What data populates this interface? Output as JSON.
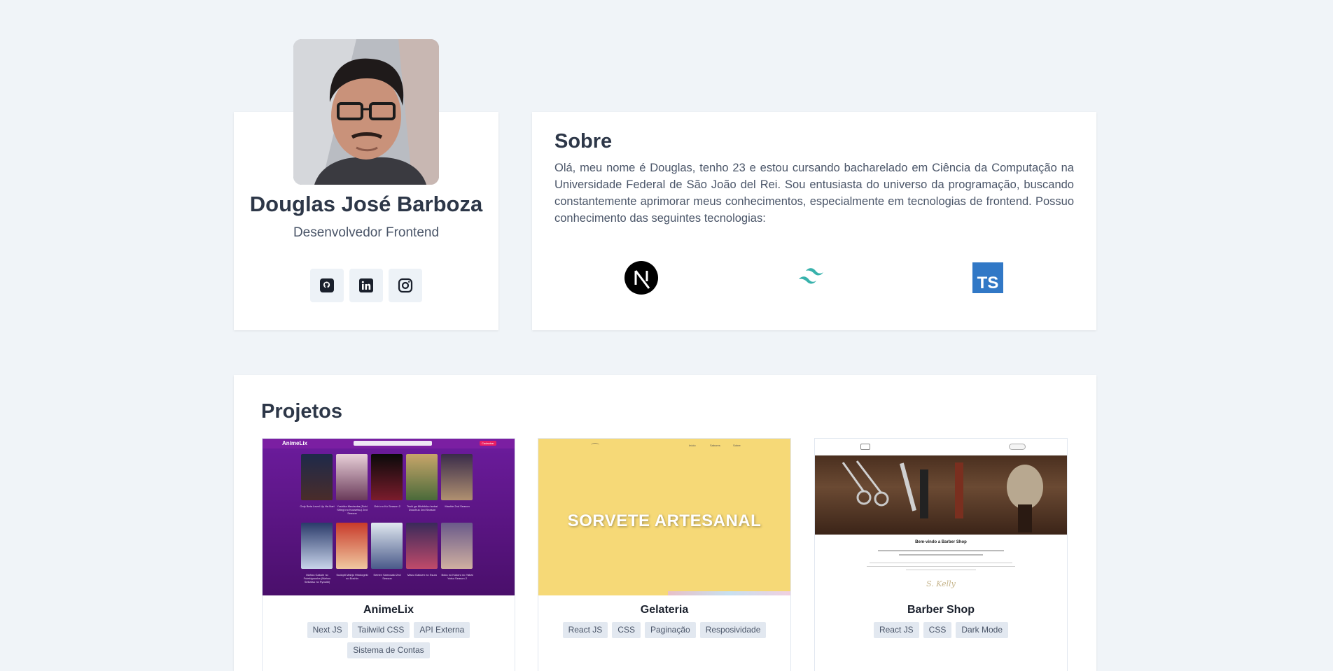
{
  "profile": {
    "name": "Douglas José Barboza",
    "role": "Desenvolvedor Frontend",
    "social": [
      {
        "icon": "github-icon"
      },
      {
        "icon": "linkedin-icon"
      },
      {
        "icon": "instagram-icon"
      }
    ]
  },
  "about": {
    "title": "Sobre",
    "text": "Olá, meu nome é Douglas, tenho 23 e estou cursando bacharelado em Ciência da Computação na Universidade Federal de São João del Rei. Sou entusiasta do universo da programação, buscando constantemente aprimorar meus conhecimentos, especialmente em tecnologias de frontend. Possuo conhecimento das seguintes tecnologias:",
    "technologies": [
      {
        "icon": "nextjs-icon",
        "color": "#000000"
      },
      {
        "icon": "tailwindcss-icon",
        "color": "#38b2ac"
      },
      {
        "icon": "typescript-icon",
        "color": "#3178c6",
        "label": "TS"
      }
    ]
  },
  "projects": {
    "title": "Projetos",
    "items": [
      {
        "name": "AnimeLix",
        "tags": [
          "Next JS",
          "Tailwild CSS",
          "API Externa",
          "Sistema de Contas"
        ],
        "thumb": {
          "logo": "AnimeLix",
          "captions": [
            "Only Beta Level Up Ha Nari",
            "Yoshida Meutsuba (Sobi Shingi no Kousetsu) 2nd Season",
            "Oshi no Ko Season 2",
            "Tsuki ga Michibiku Isekai Douchuu 2nd Season",
            "Mashle 2nd Season",
            "Mahou Gakuin no Futekigousha (Mahou Seikatsu no Ryouiki)",
            "Sudopti Mahjo Hitokogeki no Boshin",
            "Seinen Samouaki 2nd Season",
            "Maou Gakuen no Ssuru",
            "Boku no Kokoro no Yabai Yatsu Season 2"
          ],
          "header_button": "Cadastrar"
        }
      },
      {
        "name": "Gelateria",
        "tags": [
          "React JS",
          "CSS",
          "Paginação",
          "Resposividade"
        ],
        "thumb": {
          "headline": "SORVETE ARTESANAL",
          "nav": [
            "Início",
            "Sabores",
            "Sobre"
          ]
        }
      },
      {
        "name": "Barber Shop",
        "tags": [
          "React JS",
          "CSS",
          "Dark Mode"
        ],
        "thumb": {
          "welcome": "Bem-vindo a Barber Shop",
          "signature": "S. Kelly"
        }
      }
    ]
  },
  "colors": {
    "background": "#f0f4f8",
    "card": "#ffffff",
    "heading": "#2d3748",
    "text": "#4a5568",
    "tag_bg": "#e2e8f0"
  }
}
